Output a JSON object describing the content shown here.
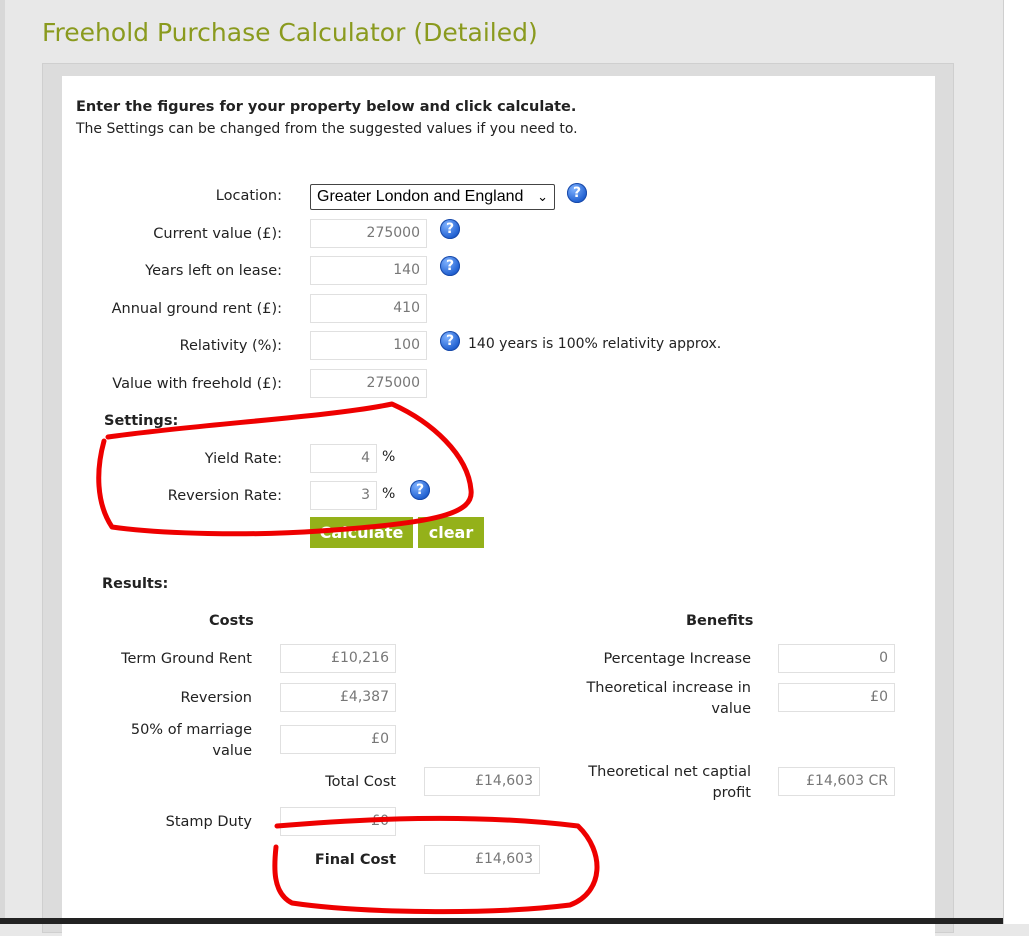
{
  "page": {
    "title": "Freehold Purchase Calculator (Detailed)"
  },
  "intro": {
    "heading": "Enter the figures for your property below and click calculate.",
    "subtext": "The Settings can be changed from the suggested values if you need to."
  },
  "form": {
    "location": {
      "label": "Location:",
      "value": "Greater London and England"
    },
    "current_value": {
      "label": "Current value (£):",
      "value": "275000"
    },
    "years_left": {
      "label": "Years left on lease:",
      "value": "140"
    },
    "ground_rent": {
      "label": "Annual ground rent (£):",
      "value": "410"
    },
    "relativity": {
      "label": "Relativity (%):",
      "value": "100",
      "note": "140 years is 100% relativity approx."
    },
    "value_freehold": {
      "label": "Value with freehold (£):",
      "value": "275000"
    }
  },
  "settings": {
    "title": "Settings:",
    "yield_rate": {
      "label": "Yield Rate:",
      "value": "4",
      "unit": "%"
    },
    "reversion_rate": {
      "label": "Reversion Rate:",
      "value": "3",
      "unit": "%"
    }
  },
  "buttons": {
    "calculate": "Calculate",
    "clear": "clear"
  },
  "help_icon_glyph": "?",
  "chevron_glyph": "⌄",
  "results": {
    "title": "Results:",
    "costs_header": "Costs",
    "benefits_header": "Benefits",
    "term_ground_rent": {
      "label": "Term Ground Rent",
      "value": "£10,216"
    },
    "reversion": {
      "label": "Reversion",
      "value": "£4,387"
    },
    "marriage_value": {
      "label_line1": "50% of marriage",
      "label_line2": "value",
      "value": "£0"
    },
    "total_cost": {
      "label": "Total Cost",
      "value": "£14,603"
    },
    "stamp_duty": {
      "label": "Stamp Duty",
      "value": "£0"
    },
    "final_cost": {
      "label": "Final Cost",
      "value": "£14,603"
    },
    "percentage_increase": {
      "label": "Percentage Increase",
      "value": "0"
    },
    "theoretical_increase": {
      "label_line1": "Theoretical increase in",
      "label_line2": "value",
      "value": "£0"
    },
    "net_profit": {
      "label_line1": "Theoretical net captial",
      "label_line2": "profit",
      "value": "£14,603 CR"
    }
  },
  "colors": {
    "title_green": "#8a9a1e",
    "button_green": "#94b11a",
    "marker_red": "#ee0000",
    "help_blue": "#1f5fd0"
  }
}
